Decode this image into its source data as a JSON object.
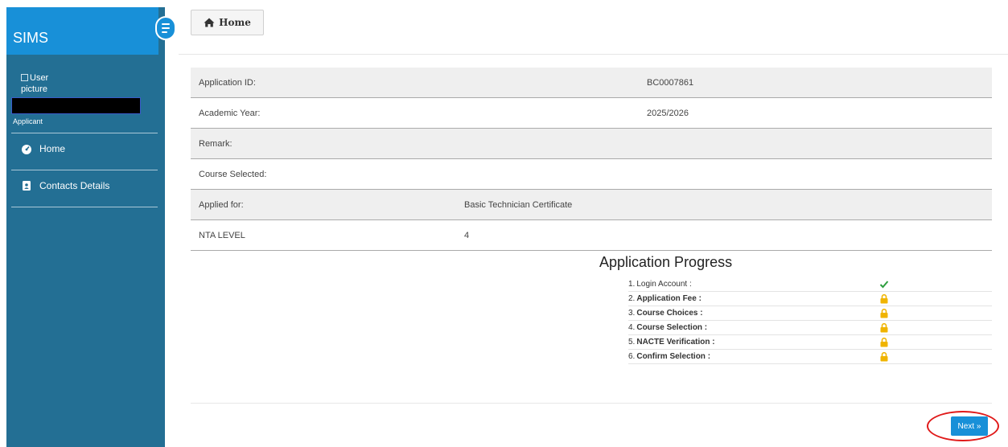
{
  "sidebar": {
    "brand": "SIMS",
    "user_picture_alt": "User picture",
    "role": "Applicant",
    "nav": [
      {
        "label": "Home",
        "icon": "dashboard-icon"
      },
      {
        "label": "Contacts Details",
        "icon": "contact-card-icon"
      }
    ]
  },
  "header": {
    "home_button": "Home"
  },
  "info": {
    "rows": [
      {
        "key": "Application ID:",
        "value": "BC0007861"
      },
      {
        "key": "Academic Year:",
        "value": "2025/2026"
      },
      {
        "key": "Remark:",
        "value": ""
      },
      {
        "key": "Course Selected:",
        "value": ""
      },
      {
        "key": "Applied for:",
        "value": "Basic Technician Certificate"
      },
      {
        "key": "NTA LEVEL",
        "value": "4"
      }
    ]
  },
  "progress": {
    "title": "Application Progress",
    "steps": [
      {
        "num": "1.",
        "label": "Login Account :",
        "status": "done",
        "icon": "checkmark-icon"
      },
      {
        "num": "2.",
        "label": "Application Fee :",
        "status": "locked",
        "icon": "lock-icon"
      },
      {
        "num": "3.",
        "label": "Course Choices :",
        "status": "locked",
        "icon": "lock-icon"
      },
      {
        "num": "4.",
        "label": "Course Selection :",
        "status": "locked",
        "icon": "lock-icon"
      },
      {
        "num": "5.",
        "label": "NACTE Verification :",
        "status": "locked",
        "icon": "lock-icon"
      },
      {
        "num": "6.",
        "label": "Confirm Selection :",
        "status": "locked",
        "icon": "lock-icon"
      }
    ]
  },
  "footer": {
    "next_button": "Next »"
  },
  "colors": {
    "sidebar": "#236f94",
    "brand": "#1890d8",
    "done": "#2e9e3e",
    "locked": "#f0b400",
    "highlight": "#e01a1a"
  }
}
